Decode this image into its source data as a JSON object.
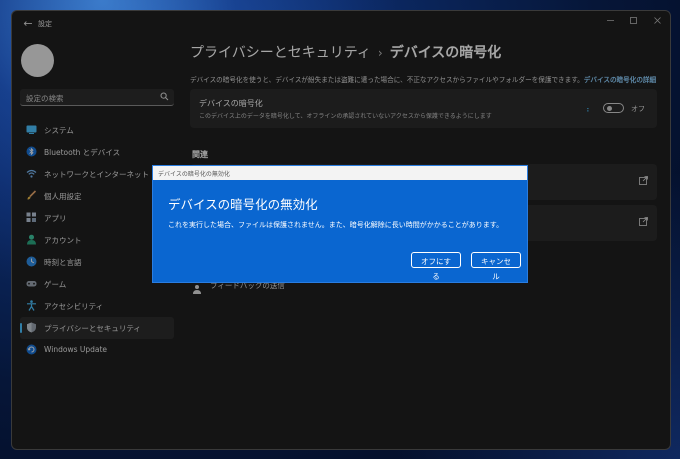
{
  "window": {
    "app_title": "設定"
  },
  "search": {
    "placeholder": "設定の検索"
  },
  "nav": {
    "items": [
      {
        "label": "システム"
      },
      {
        "label": "Bluetooth とデバイス"
      },
      {
        "label": "ネットワークとインターネット"
      },
      {
        "label": "個人用設定"
      },
      {
        "label": "アプリ"
      },
      {
        "label": "アカウント"
      },
      {
        "label": "時刻と言語"
      },
      {
        "label": "ゲーム"
      },
      {
        "label": "アクセシビリティ"
      },
      {
        "label": "プライバシーとセキュリティ",
        "active": true
      },
      {
        "label": "Windows Update"
      }
    ]
  },
  "breadcrumb": {
    "parent": "プライバシーとセキュリティ",
    "separator": "›",
    "current": "デバイスの暗号化"
  },
  "description": {
    "text": "デバイスの暗号化を使うと、デバイスが紛失または盗難に遭った場合に、不正なアクセスからファイルやフォルダーを保護できます。",
    "link": "デバイスの暗号化の詳細"
  },
  "encryption_card": {
    "title": "デバイスの暗号化",
    "subtitle": "このデバイス上のデータを暗号化して、オフラインの承認されていないアクセスから保護できるようにします",
    "toggle_state": "オフ",
    "toggle_on": false
  },
  "related": {
    "heading": "関連",
    "feedback_label": "フィードバックの送信"
  },
  "dialog": {
    "window_title": "デバイスの暗号化の無効化",
    "title": "デバイスの暗号化の無効化",
    "body": "これを実行した場合、ファイルは保護されません。また、暗号化解除に長い時間がかかることがあります。",
    "confirm_label": "オフにする",
    "cancel_label": "キャンセル"
  },
  "colors": {
    "accent": "#4cc2ff",
    "dialog_bg": "#0a66d0",
    "window_bg": "#202020",
    "card_bg": "#2b2b2b"
  }
}
